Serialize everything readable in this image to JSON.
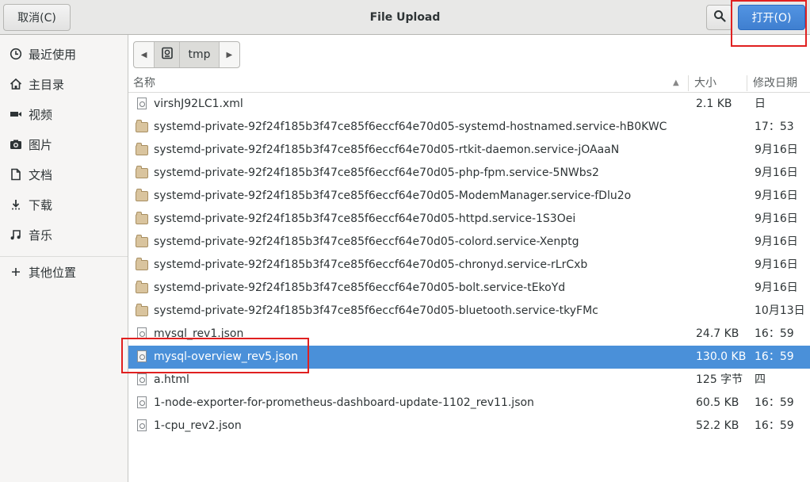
{
  "header": {
    "title": "File Upload",
    "cancel_label": "取消(C)",
    "open_label": "打开(O)",
    "search_icon": "search-icon"
  },
  "sidebar": {
    "items": [
      {
        "label": "最近使用",
        "icon": "recent-icon"
      },
      {
        "label": "主目录",
        "icon": "home-icon"
      },
      {
        "label": "视频",
        "icon": "video-icon"
      },
      {
        "label": "图片",
        "icon": "camera-icon"
      },
      {
        "label": "文档",
        "icon": "document-icon"
      },
      {
        "label": "下载",
        "icon": "download-icon"
      },
      {
        "label": "音乐",
        "icon": "music-icon"
      },
      {
        "label": "其他位置",
        "icon": "plus-icon"
      }
    ]
  },
  "pathbar": {
    "current": "tmp",
    "root_icon": "drive-icon"
  },
  "columns": {
    "name": "名称",
    "size": "大小",
    "modified": "修改日期"
  },
  "files": [
    {
      "name": "virshJ92LC1.xml",
      "size": "2.1 KB",
      "date": "日",
      "kind": "file",
      "selected": false
    },
    {
      "name": "systemd-private-92f24f185b3f47ce85f6eccf64e70d05-systemd-hostnamed.service-hB0KWC",
      "size": "",
      "date": "17：53",
      "kind": "folder",
      "selected": false
    },
    {
      "name": "systemd-private-92f24f185b3f47ce85f6eccf64e70d05-rtkit-daemon.service-jOAaaN",
      "size": "",
      "date": "9月16日",
      "kind": "folder",
      "selected": false
    },
    {
      "name": "systemd-private-92f24f185b3f47ce85f6eccf64e70d05-php-fpm.service-5NWbs2",
      "size": "",
      "date": "9月16日",
      "kind": "folder",
      "selected": false
    },
    {
      "name": "systemd-private-92f24f185b3f47ce85f6eccf64e70d05-ModemManager.service-fDlu2o",
      "size": "",
      "date": "9月16日",
      "kind": "folder",
      "selected": false
    },
    {
      "name": "systemd-private-92f24f185b3f47ce85f6eccf64e70d05-httpd.service-1S3Oei",
      "size": "",
      "date": "9月16日",
      "kind": "folder",
      "selected": false
    },
    {
      "name": "systemd-private-92f24f185b3f47ce85f6eccf64e70d05-colord.service-Xenptg",
      "size": "",
      "date": "9月16日",
      "kind": "folder",
      "selected": false
    },
    {
      "name": "systemd-private-92f24f185b3f47ce85f6eccf64e70d05-chronyd.service-rLrCxb",
      "size": "",
      "date": "9月16日",
      "kind": "folder",
      "selected": false
    },
    {
      "name": "systemd-private-92f24f185b3f47ce85f6eccf64e70d05-bolt.service-tEkoYd",
      "size": "",
      "date": "9月16日",
      "kind": "folder",
      "selected": false
    },
    {
      "name": "systemd-private-92f24f185b3f47ce85f6eccf64e70d05-bluetooth.service-tkyFMc",
      "size": "",
      "date": "10月13日",
      "kind": "folder",
      "selected": false
    },
    {
      "name": "mysql_rev1.json",
      "size": "24.7 KB",
      "date": "16：59",
      "kind": "file",
      "selected": false
    },
    {
      "name": "mysql-overview_rev5.json",
      "size": "130.0 KB",
      "date": "16：59",
      "kind": "file",
      "selected": true
    },
    {
      "name": "a.html",
      "size": "125 字节",
      "date": "四",
      "kind": "file",
      "selected": false
    },
    {
      "name": "1-node-exporter-for-prometheus-dashboard-update-1102_rev11.json",
      "size": "60.5 KB",
      "date": "16：59",
      "kind": "file",
      "selected": false
    },
    {
      "name": "1-cpu_rev2.json",
      "size": "52.2 KB",
      "date": "16：59",
      "kind": "file",
      "selected": false
    }
  ],
  "colors": {
    "selection": "#4a90d9",
    "open_button": "#4a8ad8",
    "annotation": "#e02020"
  }
}
